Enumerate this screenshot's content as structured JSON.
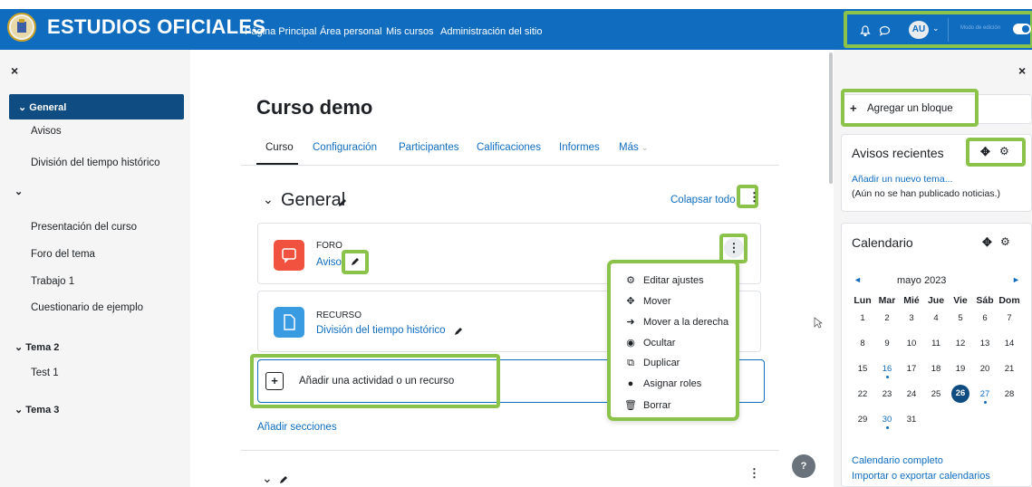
{
  "nav": {
    "brand": "ESTUDIOS OFICIALES",
    "links": [
      "Página Principal",
      "Área personal",
      "Mis cursos",
      "Administración del sitio"
    ],
    "avatar": "AU",
    "edit_mode": "Modo de edición"
  },
  "drawer": {
    "close": "×",
    "items": [
      {
        "label": "General",
        "type": "section-active"
      },
      {
        "label": "Avisos",
        "type": "item"
      },
      {
        "label": "División del tiempo histórico",
        "type": "item"
      },
      {
        "label": "",
        "type": "section"
      },
      {
        "label": "Presentación del curso",
        "type": "item"
      },
      {
        "label": "Foro del tema",
        "type": "item"
      },
      {
        "label": "Trabajo 1",
        "type": "item"
      },
      {
        "label": "Cuestionario de ejemplo",
        "type": "item"
      },
      {
        "label": "Tema 2",
        "type": "section"
      },
      {
        "label": "Test 1",
        "type": "item"
      },
      {
        "label": "Tema 3",
        "type": "section"
      }
    ]
  },
  "main": {
    "title": "Curso demo",
    "tabs": [
      "Curso",
      "Configuración",
      "Participantes",
      "Calificaciones",
      "Informes",
      "Más"
    ],
    "section": "General",
    "collapse_all": "Colapsar todo",
    "activities": [
      {
        "type": "FORO",
        "name": "Avisos"
      },
      {
        "type": "RECURSO",
        "name": "División del tiempo histórico"
      }
    ],
    "add_activity": "Añadir una actividad o un recurso",
    "add_sections": "Añadir secciones",
    "menu": [
      {
        "icon": "⚙",
        "label": "Editar ajustes"
      },
      {
        "icon": "✥",
        "label": "Mover"
      },
      {
        "icon": "➜",
        "label": "Mover a la derecha"
      },
      {
        "icon": "◉",
        "label": "Ocultar"
      },
      {
        "icon": "⧉",
        "label": "Duplicar"
      },
      {
        "icon": "●",
        "label": "Asignar roles"
      },
      {
        "icon": "🗑",
        "label": "Borrar"
      }
    ]
  },
  "right": {
    "close": "×",
    "add_block": "Agregar un bloque",
    "news": {
      "title": "Avisos recientes",
      "add": "Añadir un nuevo tema...",
      "empty": "(Aún no se han publicado noticias.)"
    },
    "calendar": {
      "title": "Calendario",
      "month": "mayo 2023",
      "days": [
        "Lun",
        "Mar",
        "Mié",
        "Jue",
        "Vie",
        "Sáb",
        "Dom"
      ],
      "weeks": [
        [
          "1",
          "2",
          "3",
          "4",
          "5",
          "6",
          "7"
        ],
        [
          "8",
          "9",
          "10",
          "11",
          "12",
          "13",
          "14"
        ],
        [
          "15",
          "16",
          "17",
          "18",
          "19",
          "20",
          "21"
        ],
        [
          "22",
          "23",
          "24",
          "25",
          "26",
          "27",
          "28"
        ],
        [
          "29",
          "30",
          "31",
          "",
          "",
          "",
          ""
        ]
      ],
      "full": "Calendario completo",
      "export": "Importar o exportar calendarios"
    }
  },
  "help": "?",
  "colors": {
    "brand": "#0f6cbf",
    "highlight": "#8bc34a",
    "forum": "#f0523f",
    "resource": "#399be2"
  }
}
